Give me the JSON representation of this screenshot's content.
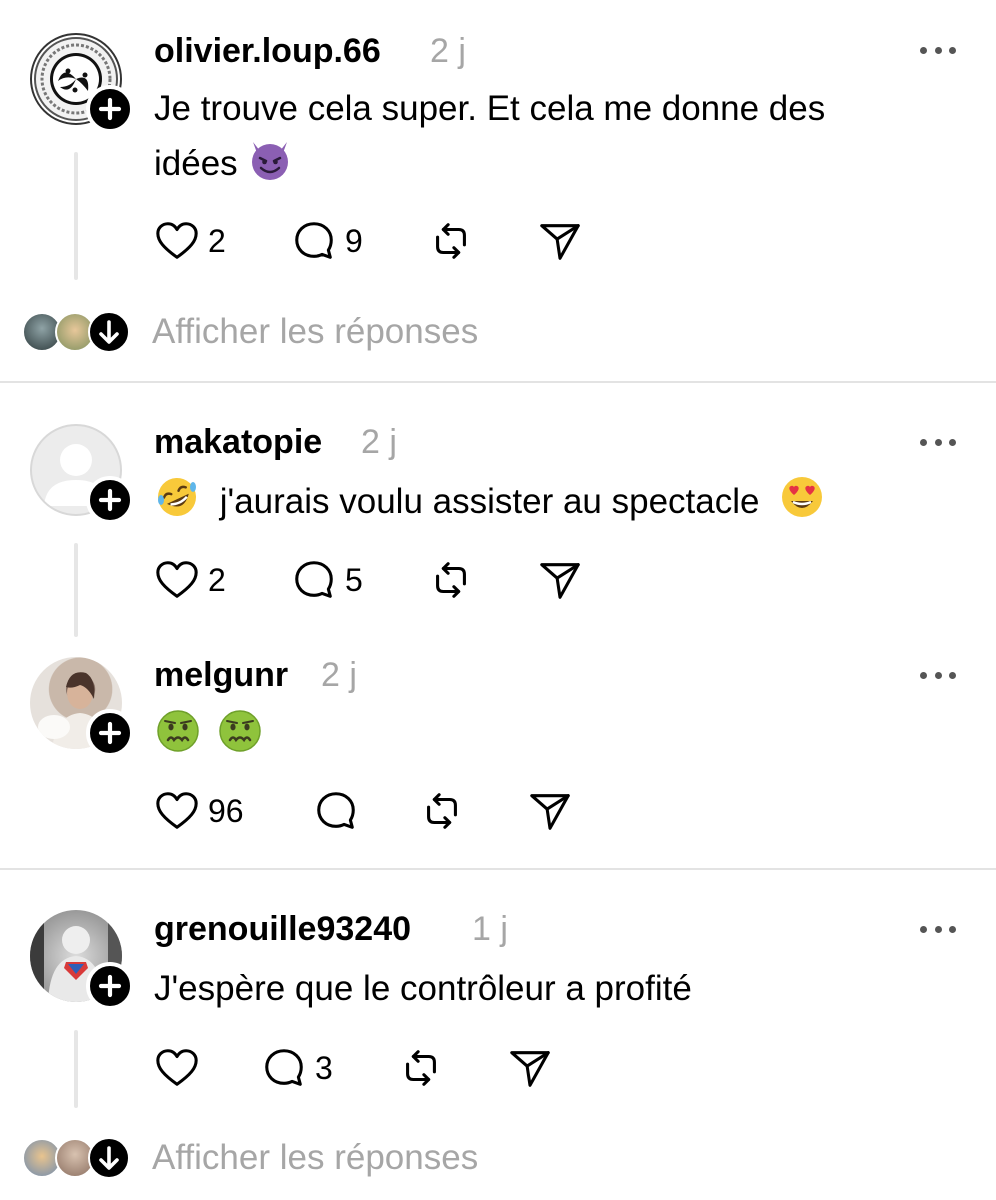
{
  "posts": [
    {
      "username": "olivier.loup.66",
      "time": "2 j",
      "text_line1": "Je trouve cela super. Et  cela me donne des",
      "text_line2": "idées",
      "emoji": "devil-emoji",
      "likes": "2",
      "replies": "9",
      "avatar_icon": "triskele-logo-icon"
    },
    {
      "username": "makatopie",
      "time": "2 j",
      "text": "j'aurais voulu assister au spectacle",
      "emoji_before": "rofl-emoji",
      "emoji_after": "heart-eyes-emoji",
      "likes": "2",
      "replies": "5",
      "avatar_icon": "default-avatar-icon"
    },
    {
      "username": "melgunr",
      "time": "2 j",
      "emojis": [
        "nauseated-face-emoji",
        "nauseated-face-emoji"
      ],
      "likes": "96",
      "replies": ""
    },
    {
      "username": "grenouille93240",
      "time": "1 j",
      "text": "J'espère que le contrôleur a profité",
      "likes": "",
      "replies": "3"
    }
  ],
  "show_replies_label": "Afficher les réponses",
  "icons": {
    "like": "heart-icon",
    "reply": "comment-bubble-icon",
    "repost": "repost-icon",
    "share": "send-icon",
    "more": "more-dots-icon",
    "follow": "plus-icon",
    "expand": "arrow-down-icon"
  },
  "colors": {
    "text": "#000000",
    "muted": "#a6a6a6",
    "divider": "#e3e3e3",
    "background": "#ffffff"
  }
}
